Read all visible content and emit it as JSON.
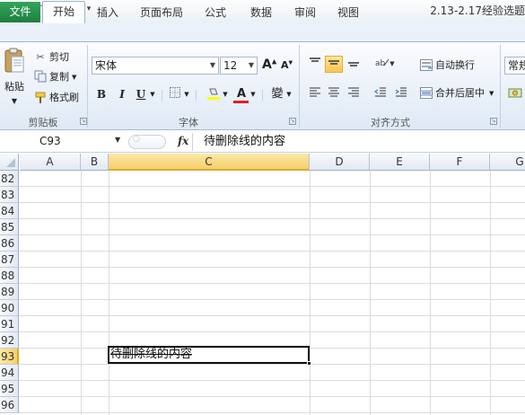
{
  "title_bar": {
    "app_logo": "X",
    "quick_access": [
      "save-icon",
      "undo-icon",
      "redo-icon",
      "customize-icon"
    ],
    "doc_title": "2.13-2.17经验选题"
  },
  "tabs": {
    "file": "文件",
    "home": "开始",
    "insert": "插入",
    "page_layout": "页面布局",
    "formulas": "公式",
    "data": "数据",
    "review": "审阅",
    "view": "视图"
  },
  "ribbon": {
    "clipboard": {
      "paste": "粘贴",
      "cut": "剪切",
      "copy": "复制",
      "format_painter": "格式刷",
      "group_label": "剪贴板"
    },
    "font": {
      "font_name": "宋体",
      "font_size": "12",
      "grow": "A",
      "shrink": "A",
      "bold": "B",
      "italic": "I",
      "underline": "U",
      "font_color_letter": "A",
      "phonetic": "變",
      "group_label": "字体"
    },
    "alignment": {
      "wrap_text": "自动换行",
      "merge_center": "合并后居中",
      "group_label": "对齐方式"
    },
    "number": {
      "format": "常规"
    }
  },
  "formula_bar": {
    "name_box": "C93",
    "fx": "fx",
    "content": "待删除线的内容"
  },
  "columns": [
    "A",
    "B",
    "C",
    "D",
    "E",
    "F",
    "G"
  ],
  "selected_column": "C",
  "rows": [
    "82",
    "83",
    "84",
    "85",
    "86",
    "87",
    "88",
    "89",
    "90",
    "91",
    "92",
    "93",
    "94",
    "95",
    "96"
  ],
  "selected_row": "93",
  "active_cell": {
    "ref": "C93",
    "text": "待删除线的内容",
    "strikethrough": true
  },
  "colors": {
    "file_tab": "#1c7f3f",
    "selection_header": "#f6cf6a",
    "font_color_bar": "#e02020",
    "highlight_bar": "#ffff00"
  }
}
